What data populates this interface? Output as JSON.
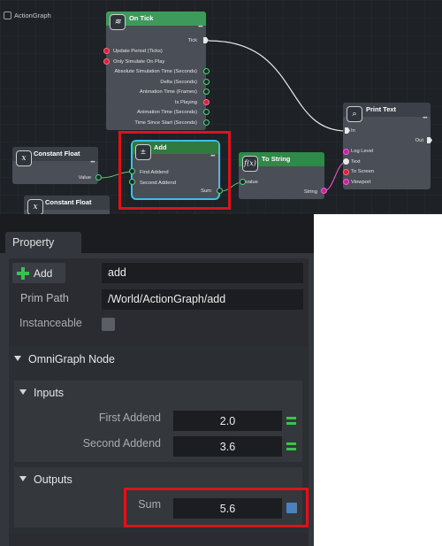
{
  "graph": {
    "title": "ActionGraph",
    "nodes": {
      "on_tick": {
        "title": "On Tick",
        "outputs": [
          "Tick",
          "Update Period (Ticks)",
          "Only Simulate On Play",
          "Absolute Simulation Time (Seconds)",
          "Delta (Seconds)",
          "Animation Time (Frames)",
          "Is Playing",
          "Animation Time (Seconds)",
          "Time Since Start (Seconds)"
        ]
      },
      "constant_float_1": {
        "title": "Constant Float",
        "output": "Value"
      },
      "constant_float_2": {
        "title": "Constant Float"
      },
      "add": {
        "title": "Add",
        "inputs": [
          "First Addend",
          "Second Addend"
        ],
        "output": "Sum"
      },
      "to_string": {
        "title": "To String",
        "input": "value",
        "output": "String"
      },
      "print_text": {
        "title": "Print Text",
        "inputs": [
          "In",
          "Log Level",
          "Text",
          "To Screen",
          "Viewport"
        ],
        "output": "Out"
      }
    },
    "colors": {
      "on_tick_header": "#3e9a5a",
      "add_header": "#2f7a3e",
      "to_string_header": "#2f8a49",
      "print_header": "#3c4048",
      "highlight": "#d6151d",
      "add_border": "#3bc2e2"
    }
  },
  "panel": {
    "tab": "Property",
    "add_button": "Add",
    "name_value": "add",
    "prim_path_label": "Prim Path",
    "prim_path_value": "/World/ActionGraph/add",
    "instanceable_label": "Instanceable",
    "omnigraph_section": "OmniGraph Node",
    "inputs_section": "Inputs",
    "first_addend_label": "First Addend",
    "first_addend_value": "2.0",
    "second_addend_label": "Second Addend",
    "second_addend_value": "3.6",
    "outputs_section": "Outputs",
    "sum_label": "Sum",
    "sum_value": "5.6"
  }
}
